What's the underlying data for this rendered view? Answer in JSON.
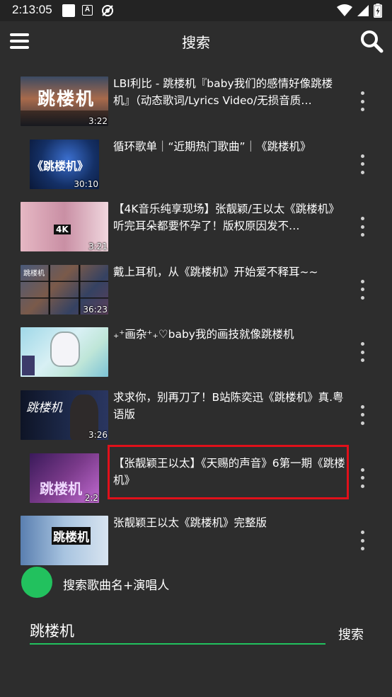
{
  "status_bar": {
    "time": "2:13:05",
    "a_icon_letter": "A",
    "icons": [
      "square-icon",
      "a-notification-icon",
      "cast-off-icon",
      "wifi-icon",
      "signal-icon",
      "battery-charging-icon"
    ]
  },
  "app_bar": {
    "title": "搜索"
  },
  "results": [
    {
      "title": "LBI利比 - 跳楼机『baby我们的感情好像跳楼机』（动态歌词/Lyrics Video/无损音质…",
      "duration": "3:22",
      "thumb_overlay": "跳楼机"
    },
    {
      "title": "循环歌单｜“近期热门歌曲”｜《跳楼机》",
      "duration": "30:10",
      "thumb_overlay": "《跳楼机》"
    },
    {
      "title": "【4K音乐纯享现场】张靓颖/王以太《跳楼机》听完耳朵都要怀孕了！版权原因发不…",
      "duration": "3:21",
      "thumb_overlay": "4K"
    },
    {
      "title": "戴上耳机，从《跳楼机》开始爱不释耳~~",
      "duration": "36:23",
      "thumb_overlay": "跳楼机"
    },
    {
      "title": "₊⁺画杂⁺₊♡baby我的画技就像跳楼机",
      "duration": "",
      "thumb_overlay": ""
    },
    {
      "title": "求求你，别再刀了！B站陈奕迅《跳楼机》真.粤语版",
      "duration": "3:26",
      "thumb_overlay": "跳楼机"
    },
    {
      "title": "【张靓颖王以太】《天赐的声音》6第一期《跳楼机》",
      "duration": "2:2",
      "thumb_overlay": "跳楼机"
    },
    {
      "title": "张靓颖王以太《跳楼机》完整版",
      "duration": "",
      "thumb_overlay": "跳楼机"
    }
  ],
  "hint": {
    "label": "搜索歌曲名+演唱人"
  },
  "search": {
    "value": "跳楼机",
    "button_label": "搜索"
  },
  "colors": {
    "background": "#2d2d2d",
    "accent": "#22c15e",
    "highlight": "#e0101a"
  }
}
